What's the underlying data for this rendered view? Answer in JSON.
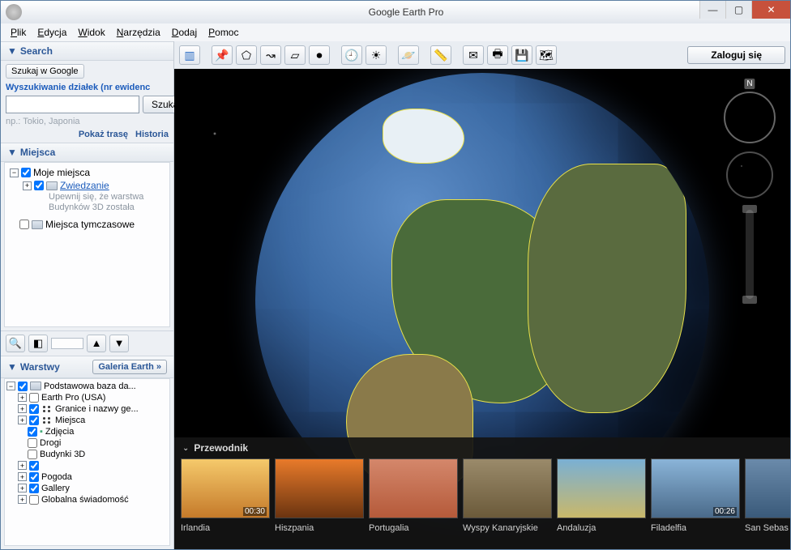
{
  "window": {
    "title": "Google Earth Pro"
  },
  "menu": {
    "file": "Plik",
    "edit": "Edycja",
    "view": "Widok",
    "tools": "Narzędzia",
    "add": "Dodaj",
    "help": "Pomoc"
  },
  "toolbar": {
    "login": "Zaloguj się"
  },
  "search": {
    "header": "Search",
    "tab_google": "Szukaj w Google",
    "tab_parcels": "Wyszukiwanie działek (nr ewidenc",
    "button": "Szukaj",
    "value": "",
    "hint": "np.: Tokio, Japonia",
    "route": "Pokaż trasę",
    "history": "Historia"
  },
  "places": {
    "header": "Miejsca",
    "my_places": "Moje miejsca",
    "tour": "Zwiedzanie",
    "tour_desc1": "Upewnij się, że warstwa",
    "tour_desc2": "Budynków 3D została",
    "temp": "Miejsca tymczasowe"
  },
  "layers": {
    "header": "Warstwy",
    "gallery": "Galeria Earth »",
    "items": {
      "base": "Podstawowa baza da...",
      "earthpro": "Earth Pro (USA)",
      "borders": "Granice i nazwy ge...",
      "places": "Miejsca",
      "photos": "Zdjęcia",
      "roads": "Drogi",
      "buildings": "Budynki 3D",
      "weather": "Pogoda",
      "gallery_item": "Gallery",
      "awareness": "Globalna świadomość"
    }
  },
  "guide": {
    "header": "Przewodnik",
    "cards": [
      {
        "label": "Irlandia",
        "time": "00:30"
      },
      {
        "label": "Hiszpania",
        "time": ""
      },
      {
        "label": "Portugalia",
        "time": ""
      },
      {
        "label": "Wyspy Kanaryjskie",
        "time": ""
      },
      {
        "label": "Andaluzja",
        "time": ""
      },
      {
        "label": "Filadelfia",
        "time": "00:26"
      },
      {
        "label": "San Sebas",
        "time": ""
      }
    ]
  }
}
